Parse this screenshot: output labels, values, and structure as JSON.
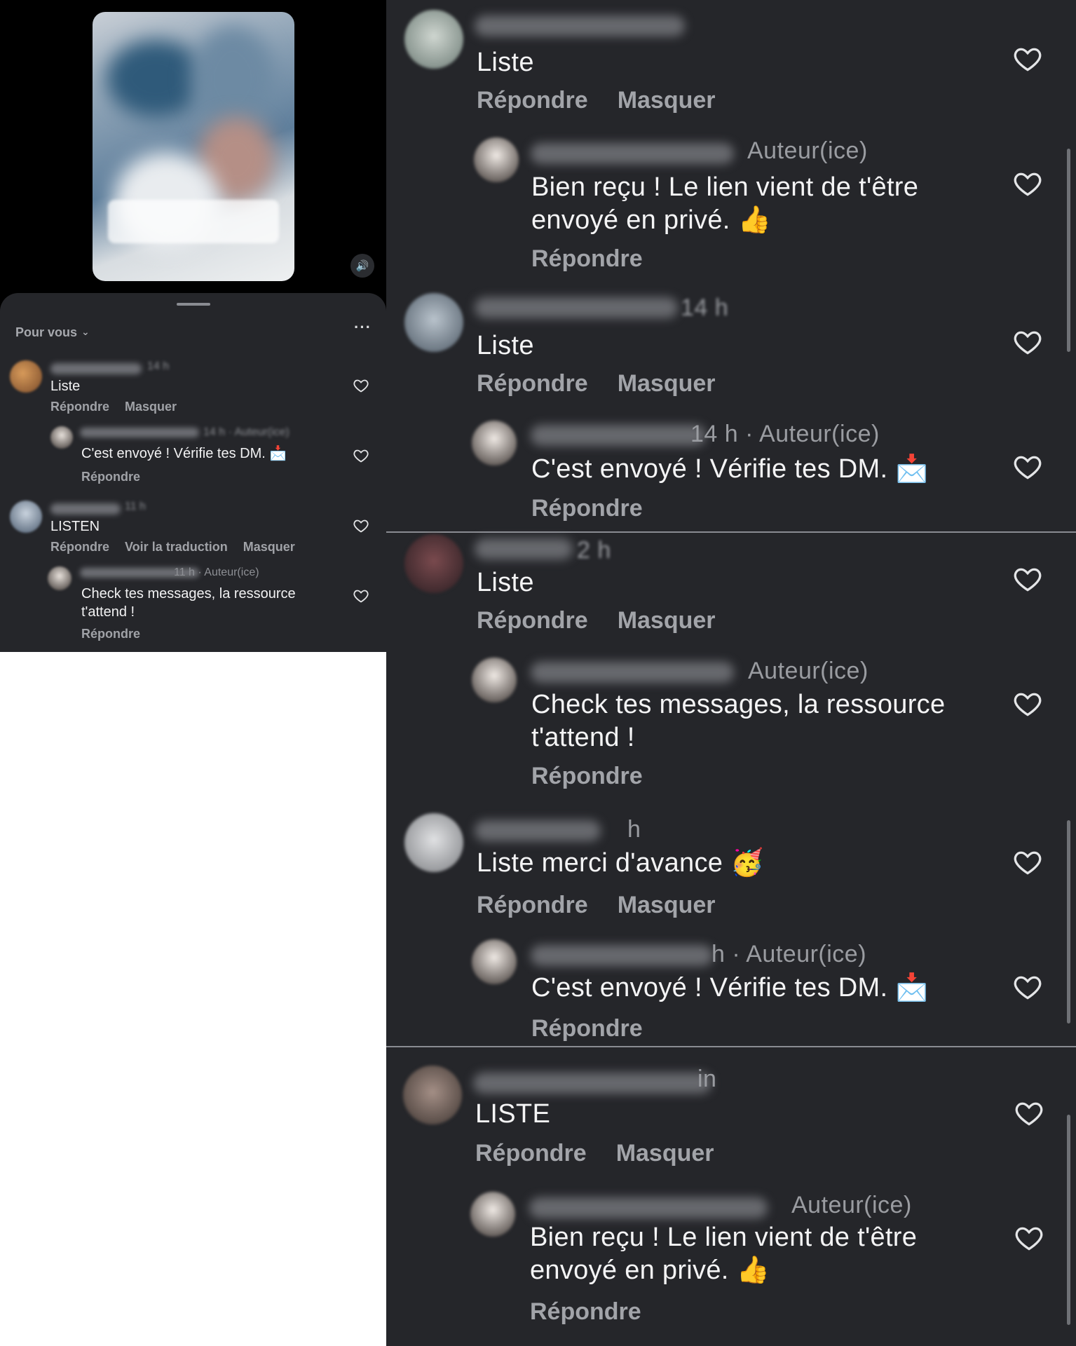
{
  "feed": {
    "selector_label": "Pour vous",
    "more_label": "···",
    "sound_icon": "speaker-icon"
  },
  "left_comments": [
    {
      "age": "14 h",
      "text": "Liste",
      "actions": [
        "Répondre",
        "Masquer"
      ],
      "reply": {
        "meta": "14 h · Auteur(ice)",
        "text": "C'est envoyé ! Vérifie tes DM. 📩",
        "actions": [
          "Répondre"
        ]
      }
    },
    {
      "age": "11 h",
      "text": "LISTEN",
      "actions": [
        "Répondre",
        "Voir la traduction",
        "Masquer"
      ],
      "reply": {
        "meta": "11 h · Auteur(ice)",
        "text": "Check tes messages, la ressource t'attend !",
        "actions": [
          "Répondre"
        ]
      }
    }
  ],
  "right_comments": [
    {
      "age": "",
      "text": "Liste",
      "actions": [
        "Répondre",
        "Masquer"
      ],
      "reply": {
        "meta": "Auteur(ice)",
        "text_line1": "Bien reçu ! Le lien vient de t'être",
        "text_line2": "envoyé en privé. 👍",
        "actions": [
          "Répondre"
        ]
      }
    },
    {
      "age": "14 h",
      "text": "Liste",
      "actions": [
        "Répondre",
        "Masquer"
      ],
      "reply": {
        "meta": "14 h · Auteur(ice)",
        "text_line1": "C'est envoyé ! Vérifie tes DM. 📩",
        "text_line2": "",
        "actions": [
          "Répondre"
        ]
      }
    },
    {
      "age": "2 h",
      "text": "Liste",
      "actions": [
        "Répondre",
        "Masquer"
      ],
      "reply": {
        "meta": "Auteur(ice)",
        "text_line1": "Check tes messages, la ressource",
        "text_line2": "t'attend !",
        "actions": [
          "Répondre"
        ]
      }
    },
    {
      "age": "h",
      "text": "Liste merci d'avance 🥳",
      "actions": [
        "Répondre",
        "Masquer"
      ],
      "reply": {
        "meta": "h · Auteur(ice)",
        "text_line1": "C'est envoyé ! Vérifie tes DM. 📩",
        "text_line2": "",
        "actions": [
          "Répondre"
        ]
      }
    },
    {
      "age": "in",
      "text": "LISTE",
      "actions": [
        "Répondre",
        "Masquer"
      ],
      "reply": {
        "meta": "Auteur(ice)",
        "text_line1": "Bien reçu ! Le lien vient de t'être",
        "text_line2": "envoyé en privé. 👍",
        "actions": [
          "Répondre"
        ]
      }
    }
  ],
  "colors": {
    "panel_bg": "#25262a",
    "text_primary": "#f4f4f5",
    "text_secondary": "#a2a4a9",
    "video_bg": "#000000"
  }
}
